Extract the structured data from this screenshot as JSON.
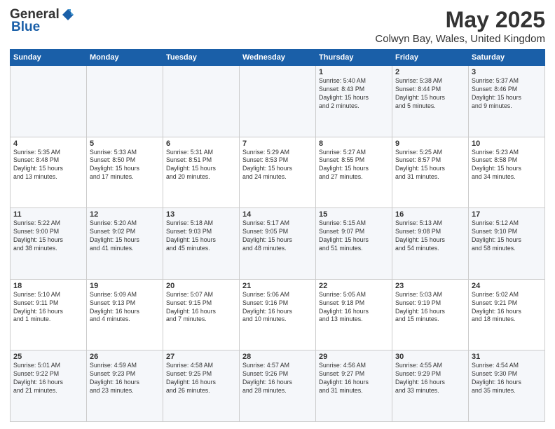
{
  "logo": {
    "general": "General",
    "blue": "Blue"
  },
  "header": {
    "month_year": "May 2025",
    "location": "Colwyn Bay, Wales, United Kingdom"
  },
  "days_of_week": [
    "Sunday",
    "Monday",
    "Tuesday",
    "Wednesday",
    "Thursday",
    "Friday",
    "Saturday"
  ],
  "weeks": [
    [
      {
        "day": "",
        "info": ""
      },
      {
        "day": "",
        "info": ""
      },
      {
        "day": "",
        "info": ""
      },
      {
        "day": "",
        "info": ""
      },
      {
        "day": "1",
        "info": "Sunrise: 5:40 AM\nSunset: 8:43 PM\nDaylight: 15 hours\nand 2 minutes."
      },
      {
        "day": "2",
        "info": "Sunrise: 5:38 AM\nSunset: 8:44 PM\nDaylight: 15 hours\nand 5 minutes."
      },
      {
        "day": "3",
        "info": "Sunrise: 5:37 AM\nSunset: 8:46 PM\nDaylight: 15 hours\nand 9 minutes."
      }
    ],
    [
      {
        "day": "4",
        "info": "Sunrise: 5:35 AM\nSunset: 8:48 PM\nDaylight: 15 hours\nand 13 minutes."
      },
      {
        "day": "5",
        "info": "Sunrise: 5:33 AM\nSunset: 8:50 PM\nDaylight: 15 hours\nand 17 minutes."
      },
      {
        "day": "6",
        "info": "Sunrise: 5:31 AM\nSunset: 8:51 PM\nDaylight: 15 hours\nand 20 minutes."
      },
      {
        "day": "7",
        "info": "Sunrise: 5:29 AM\nSunset: 8:53 PM\nDaylight: 15 hours\nand 24 minutes."
      },
      {
        "day": "8",
        "info": "Sunrise: 5:27 AM\nSunset: 8:55 PM\nDaylight: 15 hours\nand 27 minutes."
      },
      {
        "day": "9",
        "info": "Sunrise: 5:25 AM\nSunset: 8:57 PM\nDaylight: 15 hours\nand 31 minutes."
      },
      {
        "day": "10",
        "info": "Sunrise: 5:23 AM\nSunset: 8:58 PM\nDaylight: 15 hours\nand 34 minutes."
      }
    ],
    [
      {
        "day": "11",
        "info": "Sunrise: 5:22 AM\nSunset: 9:00 PM\nDaylight: 15 hours\nand 38 minutes."
      },
      {
        "day": "12",
        "info": "Sunrise: 5:20 AM\nSunset: 9:02 PM\nDaylight: 15 hours\nand 41 minutes."
      },
      {
        "day": "13",
        "info": "Sunrise: 5:18 AM\nSunset: 9:03 PM\nDaylight: 15 hours\nand 45 minutes."
      },
      {
        "day": "14",
        "info": "Sunrise: 5:17 AM\nSunset: 9:05 PM\nDaylight: 15 hours\nand 48 minutes."
      },
      {
        "day": "15",
        "info": "Sunrise: 5:15 AM\nSunset: 9:07 PM\nDaylight: 15 hours\nand 51 minutes."
      },
      {
        "day": "16",
        "info": "Sunrise: 5:13 AM\nSunset: 9:08 PM\nDaylight: 15 hours\nand 54 minutes."
      },
      {
        "day": "17",
        "info": "Sunrise: 5:12 AM\nSunset: 9:10 PM\nDaylight: 15 hours\nand 58 minutes."
      }
    ],
    [
      {
        "day": "18",
        "info": "Sunrise: 5:10 AM\nSunset: 9:11 PM\nDaylight: 16 hours\nand 1 minute."
      },
      {
        "day": "19",
        "info": "Sunrise: 5:09 AM\nSunset: 9:13 PM\nDaylight: 16 hours\nand 4 minutes."
      },
      {
        "day": "20",
        "info": "Sunrise: 5:07 AM\nSunset: 9:15 PM\nDaylight: 16 hours\nand 7 minutes."
      },
      {
        "day": "21",
        "info": "Sunrise: 5:06 AM\nSunset: 9:16 PM\nDaylight: 16 hours\nand 10 minutes."
      },
      {
        "day": "22",
        "info": "Sunrise: 5:05 AM\nSunset: 9:18 PM\nDaylight: 16 hours\nand 13 minutes."
      },
      {
        "day": "23",
        "info": "Sunrise: 5:03 AM\nSunset: 9:19 PM\nDaylight: 16 hours\nand 15 minutes."
      },
      {
        "day": "24",
        "info": "Sunrise: 5:02 AM\nSunset: 9:21 PM\nDaylight: 16 hours\nand 18 minutes."
      }
    ],
    [
      {
        "day": "25",
        "info": "Sunrise: 5:01 AM\nSunset: 9:22 PM\nDaylight: 16 hours\nand 21 minutes."
      },
      {
        "day": "26",
        "info": "Sunrise: 4:59 AM\nSunset: 9:23 PM\nDaylight: 16 hours\nand 23 minutes."
      },
      {
        "day": "27",
        "info": "Sunrise: 4:58 AM\nSunset: 9:25 PM\nDaylight: 16 hours\nand 26 minutes."
      },
      {
        "day": "28",
        "info": "Sunrise: 4:57 AM\nSunset: 9:26 PM\nDaylight: 16 hours\nand 28 minutes."
      },
      {
        "day": "29",
        "info": "Sunrise: 4:56 AM\nSunset: 9:27 PM\nDaylight: 16 hours\nand 31 minutes."
      },
      {
        "day": "30",
        "info": "Sunrise: 4:55 AM\nSunset: 9:29 PM\nDaylight: 16 hours\nand 33 minutes."
      },
      {
        "day": "31",
        "info": "Sunrise: 4:54 AM\nSunset: 9:30 PM\nDaylight: 16 hours\nand 35 minutes."
      }
    ]
  ]
}
